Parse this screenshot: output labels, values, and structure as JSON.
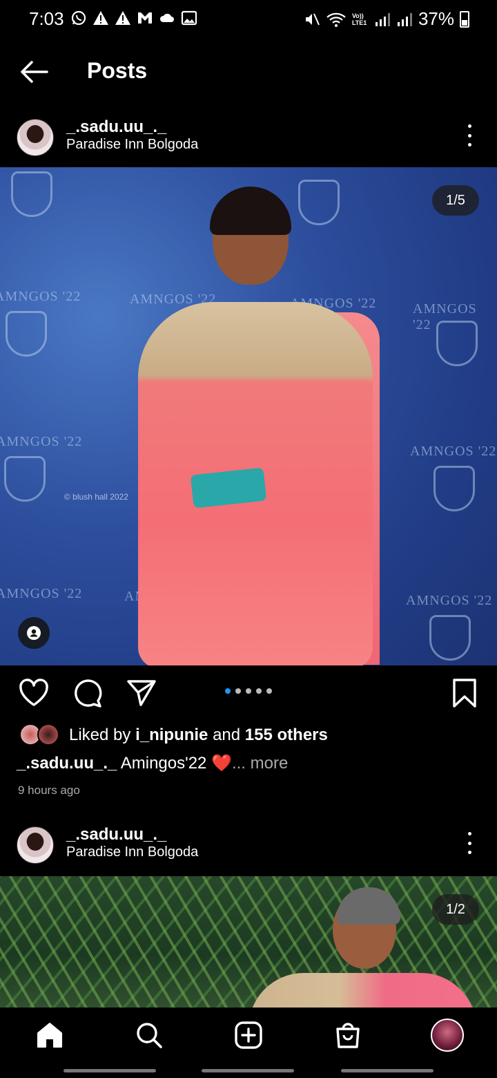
{
  "status_bar": {
    "time": "7:03",
    "left_icons": [
      "whatsapp-icon",
      "alert-icon",
      "alert-icon",
      "gmail-icon",
      "cloud-icon",
      "gallery-icon"
    ],
    "right_icons": [
      "mute-icon",
      "wifi-icon",
      "volte-icon",
      "signal-icon",
      "signal-icon"
    ],
    "volte_label": "Vo)) LTE1",
    "battery": "37%"
  },
  "header": {
    "title": "Posts",
    "back_icon": "arrow-left-icon"
  },
  "posts": [
    {
      "username": "_.sadu.uu_._",
      "location": "Paradise Inn Bolgoda",
      "counter": "1/5",
      "backdrop_text": "AMNGOS '22",
      "watermark": "© blush hall 2022",
      "dots_total": 5,
      "dots_active": 1,
      "likes_prefix": "Liked by ",
      "likes_user": "i_nipunie",
      "likes_mid": " and ",
      "likes_count": "155 others",
      "caption_user": "_.sadu.uu_._",
      "caption_text": " Amingos'22 ",
      "caption_emoji": "❤️",
      "caption_more": "... more",
      "time_ago": "9 hours ago"
    },
    {
      "username": "_.sadu.uu_._",
      "location": "Paradise Inn Bolgoda",
      "counter": "1/2"
    }
  ],
  "bottom_nav": [
    "home-icon",
    "search-icon",
    "create-post-icon",
    "shop-icon",
    "profile-avatar"
  ],
  "colors": {
    "background": "#000000",
    "active_dot": "#2196f3",
    "heart": "#e8222f",
    "muted_text": "#aaaaaa"
  }
}
